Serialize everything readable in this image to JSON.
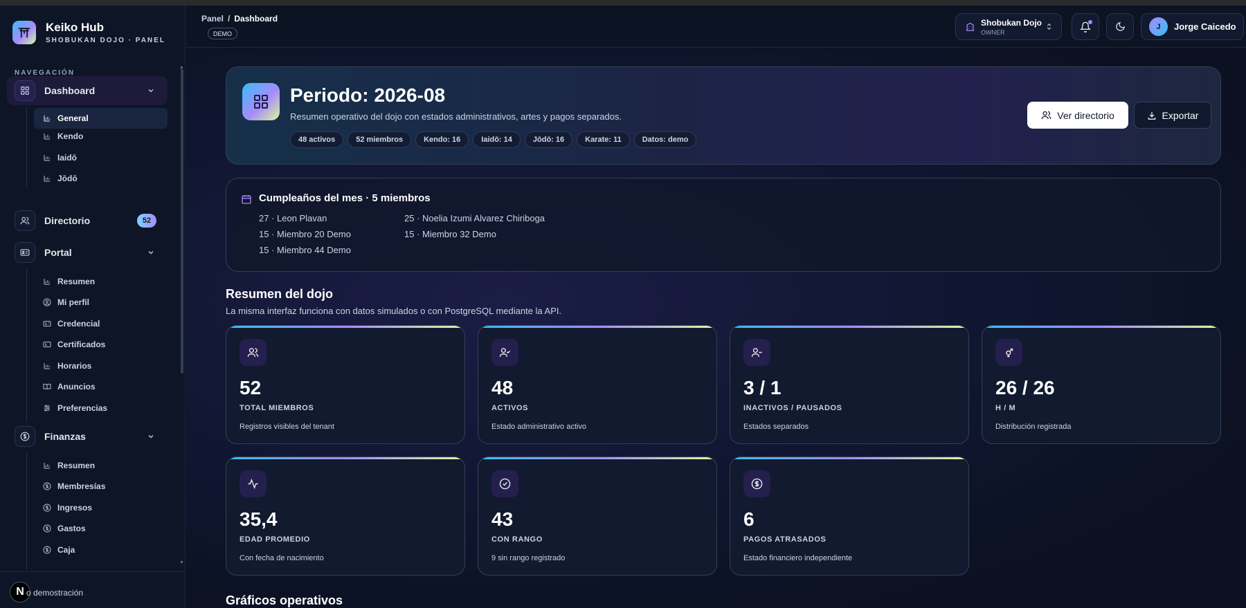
{
  "brand": {
    "name": "Keiko Hub",
    "subtitle": "SHOBUKAN DOJO · PANEL"
  },
  "sidebar": {
    "heading": "NAVEGACIÓN",
    "dashboard": {
      "label": "Dashboard",
      "sub": [
        "General",
        "Kendo",
        "Iaidō",
        "Jōdō"
      ]
    },
    "directorio": {
      "label": "Directorio",
      "badge": "52"
    },
    "portal": {
      "label": "Portal",
      "sub": [
        "Resumen",
        "Mi perfil",
        "Credencial",
        "Certificados",
        "Horarios",
        "Anuncios",
        "Preferencias"
      ]
    },
    "finanzas": {
      "label": "Finanzas",
      "sub": [
        "Resumen",
        "Membresías",
        "Ingresos",
        "Gastos",
        "Caja"
      ]
    },
    "footer_text": "o demostración",
    "footer_badge": "N"
  },
  "header": {
    "breadcrumb_root": "Panel",
    "breadcrumb_sep": "/",
    "breadcrumb_current": "Dashboard",
    "demo_pill": "DEMO",
    "tenant_name": "Shobukan Dojo",
    "tenant_role": "OWNER",
    "user_initial": "J",
    "user_name": "Jorge Caicedo"
  },
  "hero": {
    "title": "Periodo: 2026-08",
    "subtitle": "Resumen operativo del dojo con estados administrativos, artes y pagos separados.",
    "chips": [
      "48 activos",
      "52 miembros",
      "Kendo: 16",
      "Iaidō: 14",
      "Jōdō: 16",
      "Karate: 11",
      "Datos: demo"
    ],
    "btn_directory": "Ver directorio",
    "btn_export": "Exportar"
  },
  "birthdays": {
    "title": "Cumpleaños del mes · 5 miembros",
    "entries": [
      "27 · Leon Plavan",
      "25 · Noelia Izumi Alvarez Chiriboga",
      "15 · Miembro 20 Demo",
      "15 · Miembro 32 Demo",
      "15 · Miembro 44 Demo"
    ]
  },
  "summary": {
    "title": "Resumen del dojo",
    "subtitle": "La misma interfaz funciona con datos simulados o con PostgreSQL mediante la API.",
    "cards": [
      {
        "icon": "users-icon",
        "value": "52",
        "label": "TOTAL MIEMBROS",
        "note": "Registros visibles del tenant"
      },
      {
        "icon": "user-check-icon",
        "value": "48",
        "label": "ACTIVOS",
        "note": "Estado administrativo activo"
      },
      {
        "icon": "user-minus-icon",
        "value": "3 / 1",
        "label": "INACTIVOS / PAUSADOS",
        "note": "Estados separados"
      },
      {
        "icon": "gender-icon",
        "value": "26 / 26",
        "label": "H / M",
        "note": "Distribución registrada"
      },
      {
        "icon": "activity-icon",
        "value": "35,4",
        "label": "EDAD PROMEDIO",
        "note": "Con fecha de nacimiento"
      },
      {
        "icon": "check-circle-icon",
        "value": "43",
        "label": "CON RANGO",
        "note": "9 sin rango registrado"
      },
      {
        "icon": "dollar-circle-icon",
        "value": "6",
        "label": "PAGOS ATRASADOS",
        "note": "Estado financiero independiente"
      }
    ]
  },
  "charts_section": {
    "title": "Gráficos operativos"
  },
  "colors": {
    "accent_start": "#38bdf8",
    "accent_mid": "#a78bfa",
    "accent_end": "#d9f99d",
    "background": "#0b1120"
  }
}
